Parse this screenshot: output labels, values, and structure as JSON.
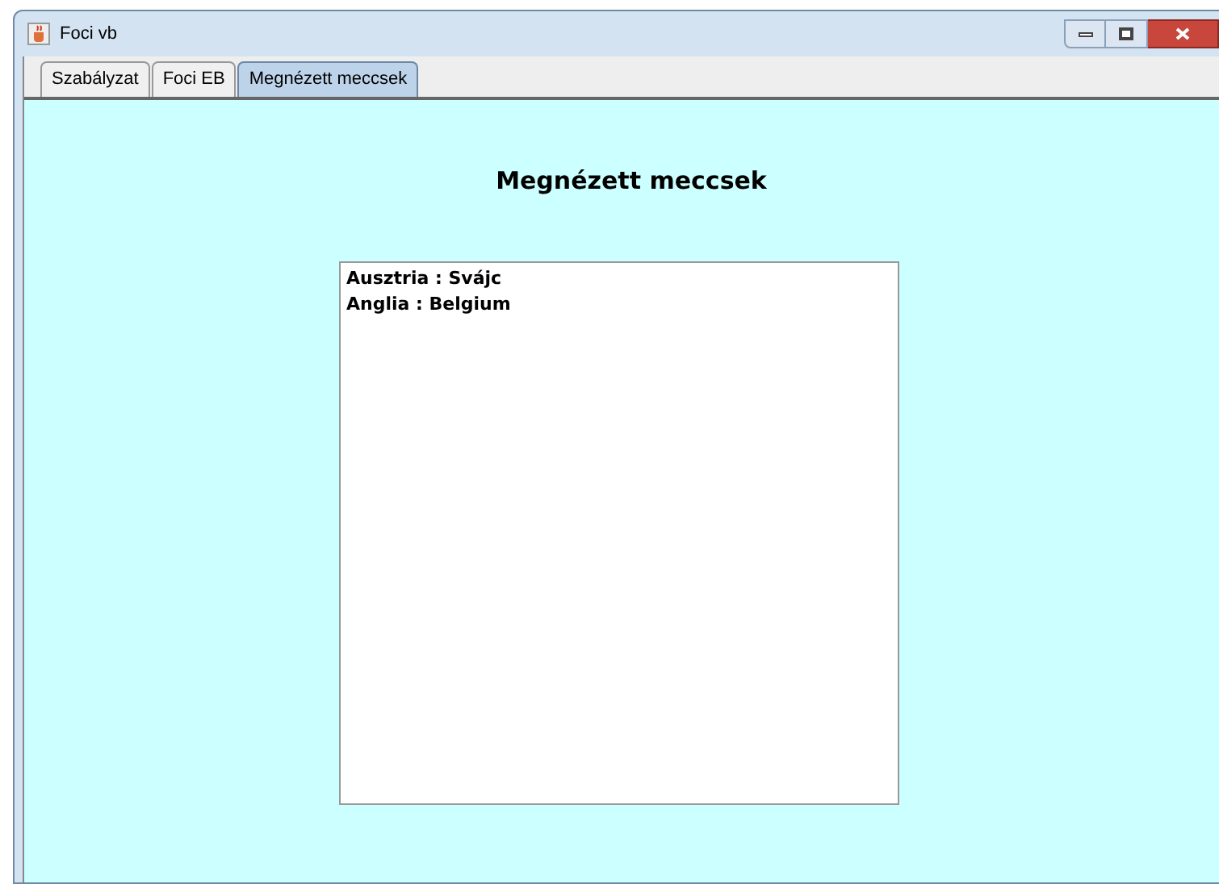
{
  "window": {
    "title": "Foci vb"
  },
  "tabs": [
    {
      "label": "Szabályzat",
      "selected": false
    },
    {
      "label": "Foci EB",
      "selected": false
    },
    {
      "label": "Megnézett meccsek",
      "selected": true
    }
  ],
  "heading": "Megnézett meccsek",
  "matches": [
    "Ausztria : Svájc",
    "Anglia : Belgium"
  ]
}
